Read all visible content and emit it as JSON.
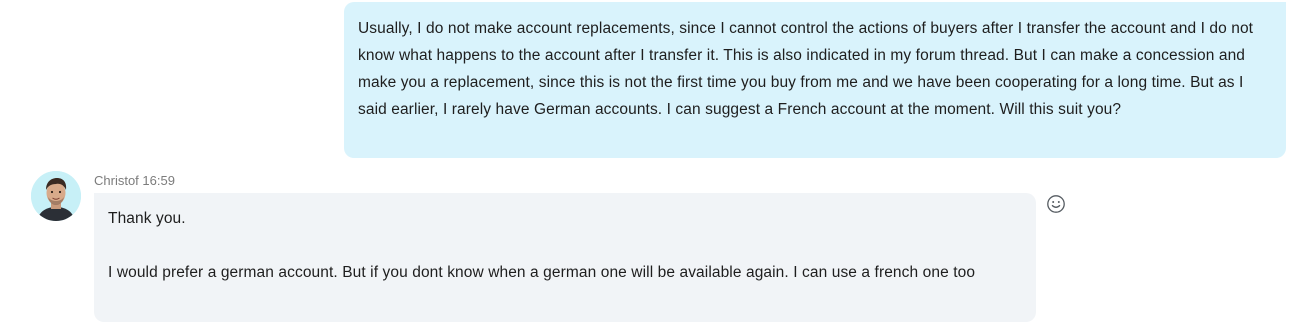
{
  "messages": {
    "outgoing": {
      "text": "Usually, I do not make account replacements, since I cannot control the actions of buyers after I transfer the account and I do not know what happens to the account after I transfer it. This is also indicated in my forum thread. But I can make a concession and make you a replacement, since this is not the first time you buy from me and we have been cooperating for a long time. But as I said earlier, I rarely have German accounts. I can suggest a French account at the moment. Will this suit you?"
    },
    "incoming": {
      "sender": "Christof",
      "time": "16:59",
      "paragraphs": [
        "Thank you.",
        "I would prefer a german account. But if you dont know when a german one will be available again. I can use a french one too"
      ]
    }
  },
  "icons": {
    "avatar": "avatar-photo",
    "reaction": "smiley-face-icon"
  },
  "colors": {
    "outgoing_bubble": "#d9f3fc",
    "incoming_bubble": "#f1f4f7",
    "meta_text": "#7c7c7c",
    "avatar_bg": "#c7f0f7"
  }
}
